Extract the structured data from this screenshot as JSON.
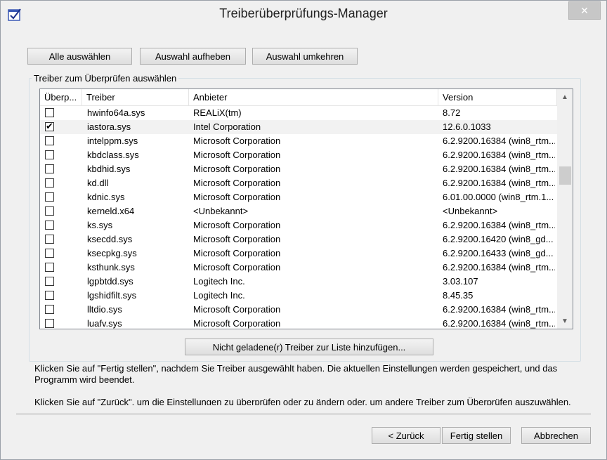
{
  "window": {
    "title": "Treiberüberprüfungs-Manager",
    "close_label": "✕"
  },
  "toolbar": {
    "select_all": "Alle auswählen",
    "deselect": "Auswahl aufheben",
    "invert": "Auswahl umkehren"
  },
  "group": {
    "legend": "Treiber zum Überprüfen auswählen"
  },
  "list": {
    "columns": [
      "Überp...",
      "Treiber",
      "Anbieter",
      "Version"
    ],
    "rows": [
      {
        "checked": false,
        "driver": "hwinfo64a.sys",
        "vendor": "REALiX(tm)",
        "version": "8.72"
      },
      {
        "checked": true,
        "driver": "iastora.sys",
        "vendor": "Intel Corporation",
        "version": "12.6.0.1033",
        "selected": true
      },
      {
        "checked": false,
        "driver": "intelppm.sys",
        "vendor": "Microsoft Corporation",
        "version": "6.2.9200.16384 (win8_rtm..."
      },
      {
        "checked": false,
        "driver": "kbdclass.sys",
        "vendor": "Microsoft Corporation",
        "version": "6.2.9200.16384 (win8_rtm..."
      },
      {
        "checked": false,
        "driver": "kbdhid.sys",
        "vendor": "Microsoft Corporation",
        "version": "6.2.9200.16384 (win8_rtm..."
      },
      {
        "checked": false,
        "driver": "kd.dll",
        "vendor": "Microsoft Corporation",
        "version": "6.2.9200.16384 (win8_rtm..."
      },
      {
        "checked": false,
        "driver": "kdnic.sys",
        "vendor": "Microsoft Corporation",
        "version": "6.01.00.0000 (win8_rtm.1..."
      },
      {
        "checked": false,
        "driver": "kerneld.x64",
        "vendor": "<Unbekannt>",
        "version": "<Unbekannt>"
      },
      {
        "checked": false,
        "driver": "ks.sys",
        "vendor": "Microsoft Corporation",
        "version": "6.2.9200.16384 (win8_rtm..."
      },
      {
        "checked": false,
        "driver": "ksecdd.sys",
        "vendor": "Microsoft Corporation",
        "version": "6.2.9200.16420 (win8_gd..."
      },
      {
        "checked": false,
        "driver": "ksecpkg.sys",
        "vendor": "Microsoft Corporation",
        "version": "6.2.9200.16433 (win8_gd..."
      },
      {
        "checked": false,
        "driver": "ksthunk.sys",
        "vendor": "Microsoft Corporation",
        "version": "6.2.9200.16384 (win8_rtm..."
      },
      {
        "checked": false,
        "driver": "lgpbtdd.sys",
        "vendor": "Logitech Inc.",
        "version": "3.03.107"
      },
      {
        "checked": false,
        "driver": "lgshidfilt.sys",
        "vendor": "Logitech Inc.",
        "version": "8.45.35"
      },
      {
        "checked": false,
        "driver": "lltdio.sys",
        "vendor": "Microsoft Corporation",
        "version": "6.2.9200.16384 (win8_rtm..."
      },
      {
        "checked": false,
        "driver": "luafv.sys",
        "vendor": "Microsoft Corporation",
        "version": "6.2.9200.16384 (win8_rtm..."
      }
    ]
  },
  "add_unloaded": "Nicht geladene(r) Treiber zur Liste hinzufügen...",
  "info": {
    "line1": "Klicken Sie auf \"Fertig stellen\", nachdem Sie Treiber ausgewählt haben. Die aktuellen Einstellungen werden gespeichert, und das Programm wird beendet.",
    "line2": "Klicken Sie auf \"Zurück\", um die Einstellungen zu überprüfen oder zu ändern oder, um andere Treiber zum Überprüfen auszuwählen."
  },
  "footer": {
    "back": "< Zurück",
    "finish": "Fertig stellen",
    "cancel": "Abbrechen"
  }
}
